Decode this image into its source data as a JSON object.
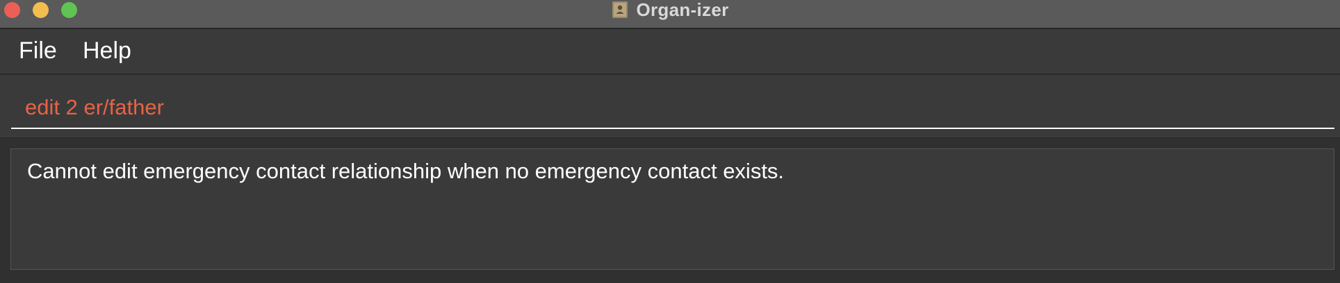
{
  "window": {
    "title": "Organ-izer",
    "icon": "document-person-icon"
  },
  "menu": {
    "items": [
      {
        "label": "File"
      },
      {
        "label": "Help"
      }
    ]
  },
  "command_box": {
    "value": "edit 2 er/father",
    "text_color": "#e66447"
  },
  "result_display": {
    "message": "Cannot edit emergency contact relationship when no emergency contact exists."
  },
  "colors": {
    "close": "#ec5f56",
    "minimize": "#f3be4f",
    "maximize": "#5fc453"
  }
}
